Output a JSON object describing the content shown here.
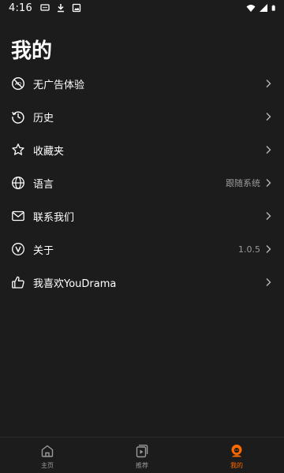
{
  "status_bar": {
    "time": "4:16",
    "left_icons": [
      "message-icon",
      "download-icon",
      "image-icon"
    ],
    "right_icons": [
      "wifi-icon",
      "signal-icon",
      "battery-icon"
    ]
  },
  "page": {
    "title": "我的"
  },
  "menu": {
    "items": [
      {
        "id": "no-ads",
        "icon": "no-ads-icon",
        "label": "无广告体验",
        "value": ""
      },
      {
        "id": "history",
        "icon": "history-icon",
        "label": "历史",
        "value": ""
      },
      {
        "id": "favorites",
        "icon": "star-icon",
        "label": "收藏夹",
        "value": ""
      },
      {
        "id": "language",
        "icon": "globe-icon",
        "label": "语言",
        "value": "跟随系统"
      },
      {
        "id": "contact",
        "icon": "mail-icon",
        "label": "联系我们",
        "value": ""
      },
      {
        "id": "about",
        "icon": "version-icon",
        "label": "关于",
        "value": "1.0.5"
      },
      {
        "id": "like",
        "icon": "thumbs-up-icon",
        "label": "我喜欢YouDrama",
        "value": ""
      }
    ]
  },
  "bottom_nav": {
    "tabs": [
      {
        "id": "home",
        "icon": "home-icon",
        "label": "主页",
        "active": false
      },
      {
        "id": "recommend",
        "icon": "video-cards-icon",
        "label": "推荐",
        "active": false
      },
      {
        "id": "mine",
        "icon": "profile-icon",
        "label": "我的",
        "active": true
      }
    ]
  },
  "colors": {
    "background": "#1c1c1c",
    "text": "#ffffff",
    "secondary_text": "#9a9a9a",
    "accent": "#ff6a00"
  }
}
